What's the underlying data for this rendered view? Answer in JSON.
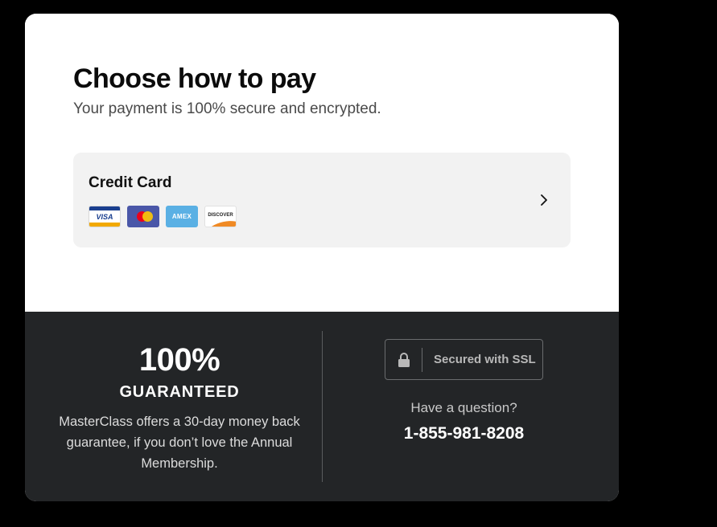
{
  "header": {
    "title": "Choose how to pay",
    "subtitle": "Your payment is 100% secure and encrypted."
  },
  "payment_option": {
    "label": "Credit Card",
    "card_logos": [
      {
        "name": "visa-logo",
        "text": "VISA"
      },
      {
        "name": "mastercard-logo",
        "text": ""
      },
      {
        "name": "amex-logo",
        "text": "AMEX"
      },
      {
        "name": "discover-logo",
        "text": "DISCOVER"
      }
    ],
    "icon": "chevron-right-icon"
  },
  "guarantee": {
    "percent": "100%",
    "title": "GUARANTEED",
    "description": "MasterClass offers a 30-day money back guarantee, if you don’t love the Annual Membership."
  },
  "security": {
    "ssl_label": "Secured with SSL",
    "icon": "lock-icon"
  },
  "support": {
    "question": "Have a question?",
    "phone": "1-855-981-8208"
  },
  "colors": {
    "footer_bg": "#232527",
    "card_bg": "#f2f2f2",
    "page_bg": "#000000"
  }
}
